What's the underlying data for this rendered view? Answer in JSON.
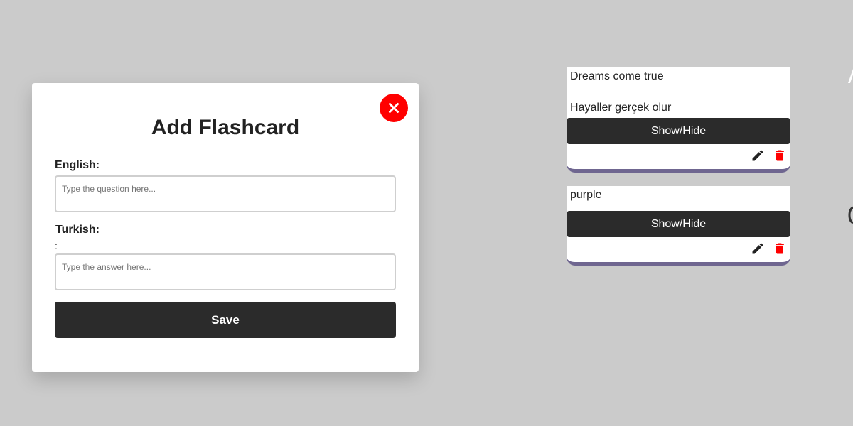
{
  "modal": {
    "title": "Add Flashcard",
    "close_icon": "close-icon",
    "english_label": "English:",
    "english_placeholder": "Type the question here...",
    "english_value": "",
    "turkish_label": "Turkish:",
    "stray_colon": ":",
    "turkish_placeholder": "Type the answer here...",
    "turkish_value": "",
    "save_label": "Save"
  },
  "cards": [
    {
      "question": "Dreams come true",
      "answer": "Hayaller gerçek olur",
      "toggle_label": "Show/Hide",
      "edit_icon": "pencil-icon",
      "delete_icon": "trash-icon"
    },
    {
      "question": "purple",
      "answer": "",
      "toggle_label": "Show/Hide",
      "edit_icon": "pencil-icon",
      "delete_icon": "trash-icon"
    }
  ],
  "colors": {
    "background": "#cbcbcb",
    "close_button": "#ff0000",
    "dark_button": "#2b2b2b",
    "delete_icon": "#ff0000",
    "card_accent": "#6f6690"
  }
}
